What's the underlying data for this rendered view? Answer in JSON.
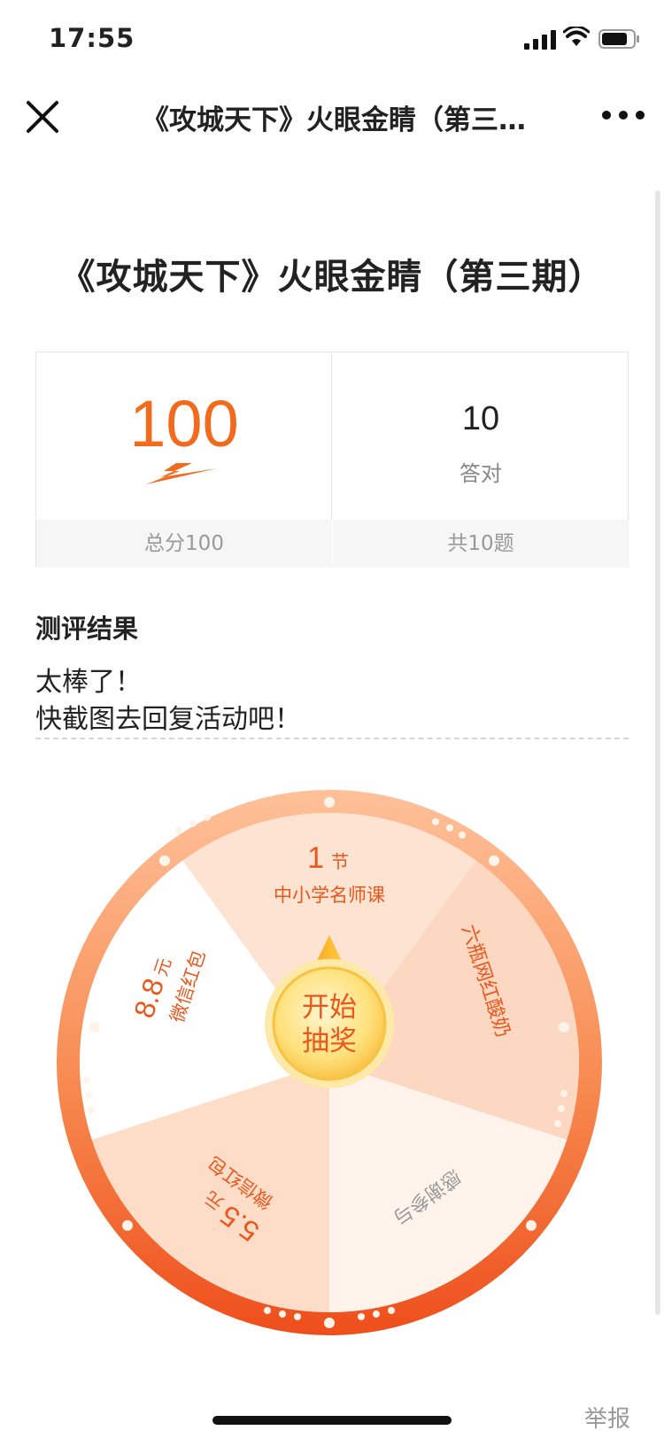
{
  "status_bar": {
    "time": "17:55"
  },
  "nav": {
    "title": "《攻城天下》火眼金睛（第三期）"
  },
  "page": {
    "title": "《攻城天下》火眼金睛（第三期）"
  },
  "score": {
    "value": "100",
    "total_label": "总分100",
    "correct_count": "10",
    "correct_label": "答对",
    "question_total_label": "共10题"
  },
  "result": {
    "heading": "测评结果",
    "line1": "太棒了！",
    "line2": "快截图去回复活动吧！"
  },
  "wheel": {
    "button_line1": "开始",
    "button_line2": "抽奖",
    "prizes": [
      {
        "amount": "1",
        "unit": "节",
        "name": "中小学名师课"
      },
      {
        "name": "六瓶网红酸奶"
      },
      {
        "name": "感谢参与"
      },
      {
        "amount": "5.5",
        "unit": "元",
        "name": "微信红包"
      },
      {
        "amount": "8.8",
        "unit": "元",
        "name": "微信红包"
      }
    ]
  },
  "footer": {
    "report_label": "举报"
  },
  "colors": {
    "accent": "#f26b1d",
    "wheel_rim": "#f47a3d"
  }
}
